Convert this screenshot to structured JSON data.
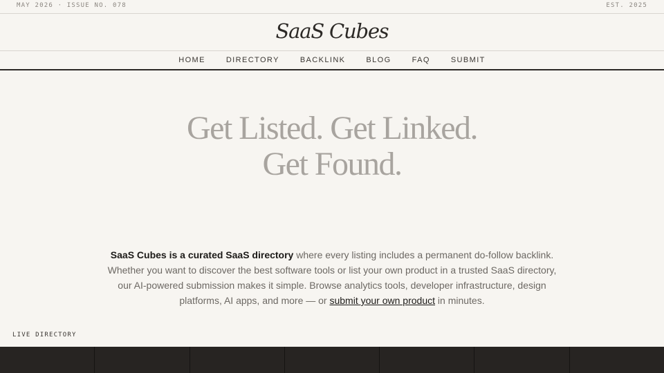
{
  "topbar": {
    "issue": "MAY 2026 · ISSUE NO. 078",
    "established": "EST. 2025"
  },
  "brand": {
    "name": "SaaS Cubes"
  },
  "nav": {
    "items": [
      "HOME",
      "DIRECTORY",
      "BACKLINK",
      "BLOG",
      "FAQ",
      "SUBMIT"
    ]
  },
  "hero": {
    "line1": "Get Listed. Get Linked.",
    "line2": "Get Found."
  },
  "intro": {
    "bold": "SaaS Cubes is a curated SaaS directory",
    "text1": " where every listing includes a permanent do-follow backlink. Whether you want to discover the best software tools or list your own product in a trusted SaaS directory, our AI-powered submission makes it simple. Browse analytics tools, developer infrastructure, design platforms, AI apps, and more — or ",
    "link": "submit your own product",
    "text2": " in minutes."
  },
  "directory": {
    "label": "LIVE DIRECTORY"
  },
  "colors": {
    "background": "#f7f5f1",
    "hero_text": "#a8a49f",
    "strip": "#272422"
  }
}
